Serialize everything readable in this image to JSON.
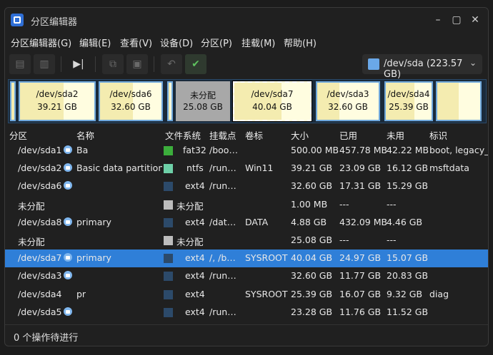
{
  "window": {
    "title": "分区编辑器"
  },
  "menu": {
    "items": [
      "分区编辑器(G)",
      "编辑(E)",
      "查看(V)",
      "设备(D)",
      "分区(P)",
      "挂载(M)",
      "帮助(H)"
    ]
  },
  "device": {
    "label": "/dev/sda  (223.57 GB)"
  },
  "diskmap": [
    {
      "name": "",
      "size": "",
      "fill": 0.9
    },
    {
      "name": "/dev/sda2",
      "size": "39.21 GB",
      "fill": 0.59
    },
    {
      "name": "/dev/sda6",
      "size": "32.60 GB",
      "fill": 0.53
    },
    {
      "name": "",
      "size": "",
      "fill": 0.5
    },
    {
      "name": "未分配",
      "size": "25.08 GB",
      "fill": 0
    },
    {
      "name": "/dev/sda7",
      "size": "40.04 GB",
      "fill": 0.62
    },
    {
      "name": "/dev/sda3",
      "size": "32.60 GB",
      "fill": 0.36
    },
    {
      "name": "/dev/sda4",
      "size": "25.39 GB",
      "fill": 0.63
    },
    {
      "name": "",
      "size": "",
      "fill": 0.5
    }
  ],
  "columns": [
    "分区",
    "名称",
    "文件系统",
    "挂载点",
    "卷标",
    "大小",
    "已用",
    "未用",
    "标识"
  ],
  "rows": [
    {
      "partition": "/dev/sda1",
      "lock": true,
      "name": "Ba",
      "color": "#3cae3c",
      "fs": "fat32",
      "mount": "/boo…",
      "label": "",
      "size": "500.00 MB",
      "used": "457.78 MB",
      "unused": "42.22 MB",
      "flags": "boot, legacy_b"
    },
    {
      "partition": "/dev/sda2",
      "lock": true,
      "name": "Basic data partition",
      "color": "#6ed0a8",
      "fs": "ntfs",
      "mount": "/run…",
      "label": "Win11",
      "size": "39.21 GB",
      "used": "23.09 GB",
      "unused": "16.12 GB",
      "flags": "msftdata"
    },
    {
      "partition": "/dev/sda6",
      "lock": true,
      "name": "",
      "color": "#2c4a6a",
      "fs": "ext4",
      "mount": "/run…",
      "label": "",
      "size": "32.60 GB",
      "used": "17.31 GB",
      "unused": "15.29 GB",
      "flags": ""
    },
    {
      "partition": "未分配",
      "lock": false,
      "name": "",
      "color": "#bdbdbd",
      "fs": "未分配",
      "mount": "",
      "label": "",
      "size": "1.00 MB",
      "used": "---",
      "unused": "---",
      "flags": ""
    },
    {
      "partition": "/dev/sda8",
      "lock": true,
      "name": "primary",
      "color": "#2c4a6a",
      "fs": "ext4",
      "mount": "/dat…",
      "label": "DATA",
      "size": "4.88 GB",
      "used": "432.09 MB",
      "unused": "4.46 GB",
      "flags": ""
    },
    {
      "partition": "未分配",
      "lock": false,
      "name": "",
      "color": "#bdbdbd",
      "fs": "未分配",
      "mount": "",
      "label": "",
      "size": "25.08 GB",
      "used": "---",
      "unused": "---",
      "flags": ""
    },
    {
      "partition": "/dev/sda7",
      "lock": true,
      "name": "primary",
      "color": "#2c4a6a",
      "fs": "ext4",
      "mount": "/, /b…",
      "label": "SYSROOT",
      "size": "40.04 GB",
      "used": "24.97 GB",
      "unused": "15.07 GB",
      "flags": "",
      "selected": true
    },
    {
      "partition": "/dev/sda3",
      "lock": true,
      "name": "",
      "color": "#2c4a6a",
      "fs": "ext4",
      "mount": "/run…",
      "label": "",
      "size": "32.60 GB",
      "used": "11.77 GB",
      "unused": "20.83 GB",
      "flags": ""
    },
    {
      "partition": "/dev/sda4",
      "lock": false,
      "name": "pr",
      "color": "#2c4a6a",
      "fs": "ext4",
      "mount": "",
      "label": "SYSROOT",
      "size": "25.39 GB",
      "used": "16.07 GB",
      "unused": "9.32 GB",
      "flags": "diag"
    },
    {
      "partition": "/dev/sda5",
      "lock": true,
      "name": "",
      "color": "#2c4a6a",
      "fs": "ext4",
      "mount": "/run…",
      "label": "",
      "size": "23.28 GB",
      "used": "11.76 GB",
      "unused": "11.52 GB",
      "flags": ""
    }
  ],
  "status": {
    "text": "0 个操作待进行"
  }
}
